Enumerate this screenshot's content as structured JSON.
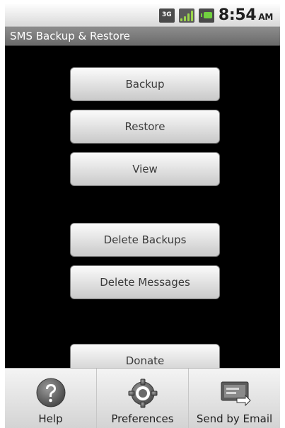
{
  "status_bar": {
    "network_label": "3G",
    "time": "8:54",
    "ampm": "AM"
  },
  "app": {
    "title": "SMS Backup & Restore"
  },
  "buttons": {
    "backup": "Backup",
    "restore": "Restore",
    "view": "View",
    "delete_backups": "Delete Backups",
    "delete_messages": "Delete Messages",
    "donate": "Donate"
  },
  "bottom_menu": {
    "help": "Help",
    "preferences": "Preferences",
    "send_by_email": "Send by Email"
  },
  "colors": {
    "screen_bg": "#000000",
    "title_bar": "#7a7a7a",
    "signal_green": "#9bd54b"
  },
  "icons": [
    "three-g-icon",
    "signal-icon",
    "battery-icon",
    "help-icon",
    "preferences-icon",
    "email-icon"
  ]
}
